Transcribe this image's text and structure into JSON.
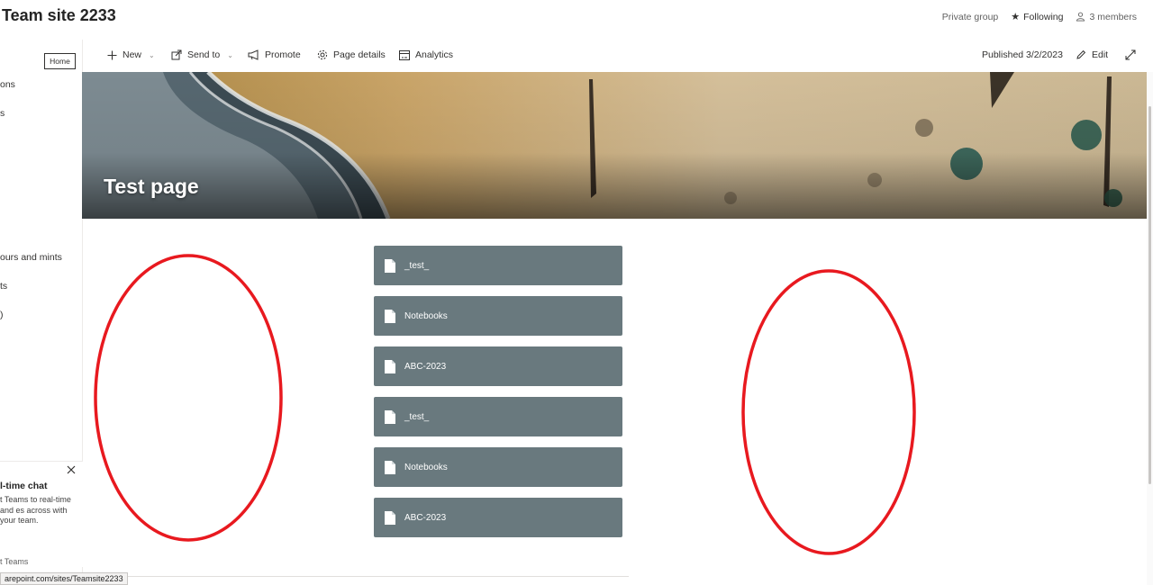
{
  "header": {
    "site_title": "Team site 2233",
    "privacy": "Private group",
    "following": "Following",
    "members": "3 members"
  },
  "leftnav": {
    "tooltip": "Home",
    "items": [
      {
        "label": "ons"
      },
      {
        "label": "s"
      },
      {
        "label": "ours and mints"
      },
      {
        "label": "ts"
      },
      {
        "label": ")"
      }
    ],
    "teams_promo": {
      "title": "l-time chat",
      "description": "t Teams to real-time and es across with your team.",
      "link": "t Teams"
    }
  },
  "commandbar": {
    "new": "New",
    "send_to": "Send to",
    "promote": "Promote",
    "page_details": "Page details",
    "analytics": "Analytics",
    "published": "Published 3/2/2023",
    "edit": "Edit"
  },
  "hero": {
    "title": "Test page"
  },
  "documents": [
    {
      "label": "_test_"
    },
    {
      "label": "Notebooks"
    },
    {
      "label": "ABC-2023"
    },
    {
      "label": "_test_"
    },
    {
      "label": "Notebooks"
    },
    {
      "label": "ABC-2023"
    }
  ],
  "statusbar": {
    "url": "arepoint.com/sites/Teamsite2233"
  },
  "colors": {
    "tile": "#69797e",
    "annotation": "#e8191f",
    "sand": "#c8b08a"
  }
}
